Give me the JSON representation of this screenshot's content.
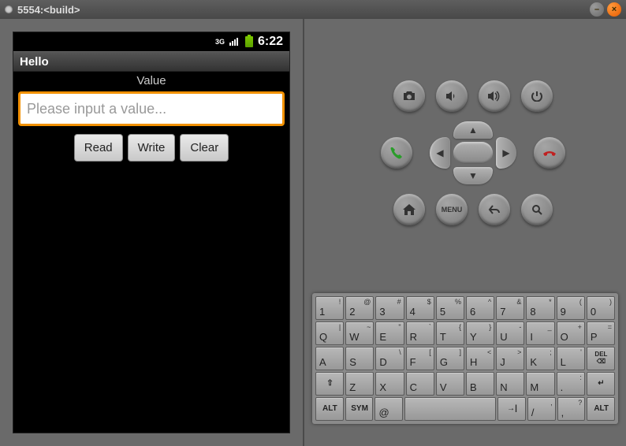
{
  "window": {
    "title": "5554:<build>"
  },
  "status": {
    "net": "3G",
    "time": "6:22"
  },
  "app": {
    "title": "Hello",
    "value_label": "Value",
    "input_placeholder": "Please input a value...",
    "buttons": {
      "read": "Read",
      "write": "Write",
      "clear": "Clear"
    }
  },
  "ctrl": {
    "camera": "camera",
    "vol_down": "volume-down",
    "vol_up": "volume-up",
    "power": "power",
    "call": "call",
    "end": "end-call",
    "home": "home",
    "menu": "MENU",
    "back": "back",
    "search": "search"
  },
  "kb": {
    "r1": [
      {
        "m": "1",
        "s": "!"
      },
      {
        "m": "2",
        "s": "@"
      },
      {
        "m": "3",
        "s": "#"
      },
      {
        "m": "4",
        "s": "$"
      },
      {
        "m": "5",
        "s": "%"
      },
      {
        "m": "6",
        "s": "^"
      },
      {
        "m": "7",
        "s": "&"
      },
      {
        "m": "8",
        "s": "*"
      },
      {
        "m": "9",
        "s": "("
      },
      {
        "m": "0",
        "s": ")"
      }
    ],
    "r2": [
      {
        "m": "Q",
        "s": "|"
      },
      {
        "m": "W",
        "s": "~"
      },
      {
        "m": "E",
        "s": "\""
      },
      {
        "m": "R",
        "s": "`"
      },
      {
        "m": "T",
        "s": "{"
      },
      {
        "m": "Y",
        "s": "}"
      },
      {
        "m": "U",
        "s": "-"
      },
      {
        "m": "I",
        "s": "_"
      },
      {
        "m": "O",
        "s": "+"
      },
      {
        "m": "P",
        "s": "="
      }
    ],
    "r3": [
      {
        "m": "A",
        "s": ""
      },
      {
        "m": "S",
        "s": ""
      },
      {
        "m": "D",
        "s": "\\"
      },
      {
        "m": "F",
        "s": "["
      },
      {
        "m": "G",
        "s": "]"
      },
      {
        "m": "H",
        "s": "<"
      },
      {
        "m": "J",
        "s": ">"
      },
      {
        "m": "K",
        "s": ";"
      },
      {
        "m": "L",
        "s": "'"
      },
      {
        "m": "DEL",
        "s": "",
        "fn": true,
        "name": "delete-key"
      }
    ],
    "r4": [
      {
        "m": "⇧",
        "s": "",
        "fn": true,
        "name": "shift-key"
      },
      {
        "m": "Z",
        "s": ""
      },
      {
        "m": "X",
        "s": ""
      },
      {
        "m": "C",
        "s": ""
      },
      {
        "m": "V",
        "s": ""
      },
      {
        "m": "B",
        "s": ""
      },
      {
        "m": "N",
        "s": ""
      },
      {
        "m": "M",
        "s": ""
      },
      {
        "m": ".",
        "s": ":"
      },
      {
        "m": "↵",
        "s": "",
        "fn": true,
        "name": "enter-key"
      }
    ],
    "r5": [
      {
        "m": "ALT",
        "fn": true,
        "name": "alt-key"
      },
      {
        "m": "SYM",
        "fn": true,
        "name": "sym-key"
      },
      {
        "m": "@",
        "name": "at-key"
      },
      {
        "m": "",
        "space": true,
        "name": "space-key"
      },
      {
        "m": "→|",
        "fn": true,
        "name": "tab-key"
      },
      {
        "m": "/",
        "s": ","
      },
      {
        "m": ",",
        "s": "?"
      },
      {
        "m": "ALT",
        "fn": true,
        "name": "alt-key-right"
      }
    ]
  }
}
